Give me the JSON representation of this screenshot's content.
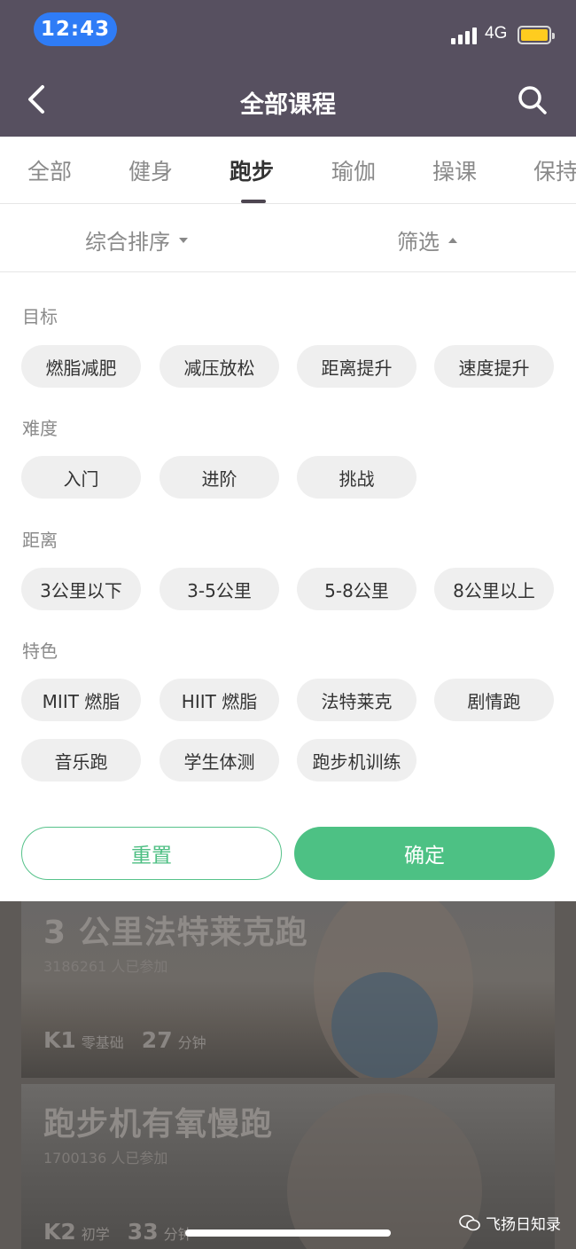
{
  "status_bar": {
    "time": "12:43",
    "network": "4G",
    "colors": {
      "time_pill": "#2f7cf6",
      "battery": "#ffcc1f"
    }
  },
  "nav": {
    "title": "全部课程",
    "back_icon": "chevron-left-icon",
    "search_icon": "search-icon"
  },
  "tabs": [
    {
      "label": "全部",
      "active": false
    },
    {
      "label": "健身",
      "active": false
    },
    {
      "label": "跑步",
      "active": true
    },
    {
      "label": "瑜伽",
      "active": false
    },
    {
      "label": "操课",
      "active": false
    },
    {
      "label": "保持",
      "active": false
    }
  ],
  "sort_bar": {
    "sort_label": "综合排序",
    "filter_label": "筛选"
  },
  "filters": {
    "goal": {
      "label": "目标",
      "options": [
        "燃脂减肥",
        "减压放松",
        "距离提升",
        "速度提升"
      ]
    },
    "difficulty": {
      "label": "难度",
      "options": [
        "入门",
        "进阶",
        "挑战"
      ]
    },
    "distance": {
      "label": "距离",
      "options": [
        "3公里以下",
        "3-5公里",
        "5-8公里",
        "8公里以上"
      ]
    },
    "feature": {
      "label": "特色",
      "options": [
        "MIIT 燃脂",
        "HIIT 燃脂",
        "法特莱克",
        "剧情跑",
        "音乐跑",
        "学生体测",
        "跑步机训练"
      ]
    }
  },
  "actions": {
    "reset": "重置",
    "confirm": "确定",
    "accent_color": "#4dc184"
  },
  "courses": [
    {
      "title": "3 公里法特莱克跑",
      "participants": "3186261 人已参加",
      "level": "K1",
      "level_desc": "零基础",
      "duration": "27",
      "duration_unit": "分钟"
    },
    {
      "title": "跑步机有氧慢跑",
      "participants": "1700136 人已参加",
      "level": "K2",
      "level_desc": "初学",
      "duration": "33",
      "duration_unit": "分钟"
    }
  ],
  "watermark": "飞扬日知录"
}
